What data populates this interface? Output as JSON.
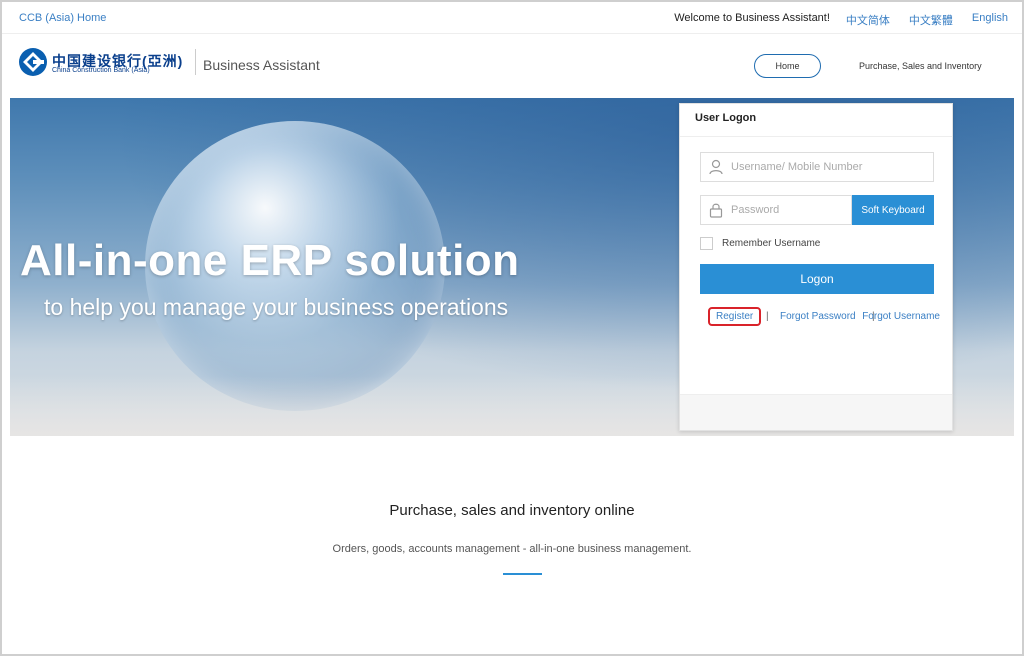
{
  "topbar": {
    "home_link": "CCB (Asia) Home",
    "welcome": "Welcome to Business Assistant!",
    "lang_simplified": "中文简体",
    "lang_traditional": "中文繁體",
    "lang_english": "English"
  },
  "header": {
    "logo_cn": "中国建设银行(亞洲)",
    "logo_en": "China Construction Bank (Asia)",
    "brand": "Business Assistant",
    "nav_home": "Home",
    "nav_psi": "Purchase, Sales and Inventory"
  },
  "hero": {
    "title": "All-in-one ERP solution",
    "subtitle": "to help you manage your business operations"
  },
  "login": {
    "title": "User Logon",
    "username_placeholder": "Username/ Mobile Number",
    "password_placeholder": "Password",
    "soft_keyboard": "Soft Keyboard",
    "remember": "Remember Username",
    "logon": "Logon",
    "register": "Register",
    "sep": "|",
    "forgot_password": "Forgot Password",
    "forgot_username": "Forgot Username"
  },
  "section": {
    "title": "Purchase, sales and inventory online",
    "description": "Orders, goods, accounts management - all-in-one business management."
  },
  "colors": {
    "accent": "#2a8fd5",
    "link": "#3a7fc4",
    "brand_blue": "#0a3f8c",
    "highlight_red": "#d9232a"
  }
}
